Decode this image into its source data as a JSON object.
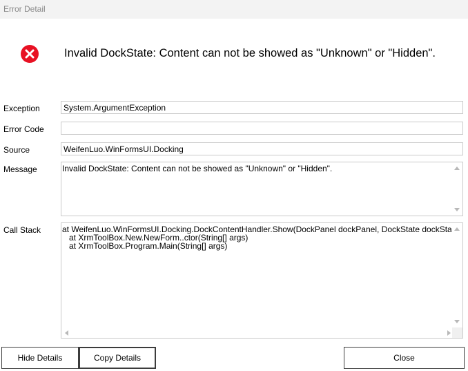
{
  "window": {
    "title": "Error Detail"
  },
  "icon": {
    "name": "error-icon",
    "color": "#e81123"
  },
  "headline": "Invalid DockState: Content can not be showed as \"Unknown\" or \"Hidden\".",
  "fields": {
    "exception": {
      "label": "Exception",
      "value": "System.ArgumentException"
    },
    "error_code": {
      "label": "Error Code",
      "value": ""
    },
    "source": {
      "label": "Source",
      "value": "WeifenLuo.WinFormsUI.Docking"
    },
    "message": {
      "label": "Message",
      "value": "Invalid DockState: Content can not be showed as \"Unknown\" or \"Hidden\"."
    },
    "call_stack": {
      "label": "Call Stack",
      "value": "at WeifenLuo.WinFormsUI.Docking.DockContentHandler.Show(DockPanel dockPanel, DockState dockState)\n   at XrmToolBox.New.NewForm..ctor(String[] args)\n   at XrmToolBox.Program.Main(String[] args)"
    }
  },
  "buttons": {
    "hide_details": "Hide Details",
    "copy_details": "Copy Details",
    "close": "Close"
  }
}
